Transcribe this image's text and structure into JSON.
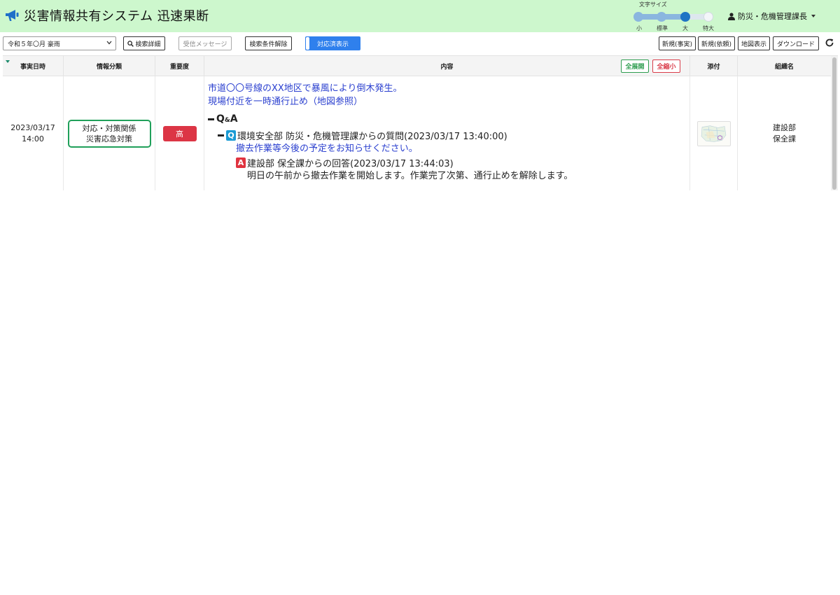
{
  "header": {
    "title": "災害情報共有システム 迅速果断",
    "font_size": {
      "label": "文字サイズ",
      "options": [
        "小",
        "標準",
        "大",
        "特大"
      ],
      "selected_index": 2
    },
    "user_name": "防災・危機管理課長"
  },
  "toolbar": {
    "event_select": "令和５年〇月 豪雨",
    "search_detail": "検索詳細",
    "received_messages": "受信メッセージ",
    "clear_conditions": "検索条件解除",
    "show_resolved": "対応済表示",
    "new_fact": "新規(事実)",
    "new_request": "新規(依頼)",
    "map_view": "地図表示",
    "download": "ダウンロード"
  },
  "table": {
    "columns": {
      "datetime": "事実日時",
      "category": "情報分類",
      "priority": "重要度",
      "content": "内容",
      "attachment": "添付",
      "organization": "組織名"
    },
    "expand_all": "全展開",
    "collapse_all": "全縮小",
    "rows": [
      {
        "date": "2023/03/17",
        "time": "14:00",
        "category_line1": "対応・対策関係",
        "category_line2": "災害応急対策",
        "priority": "高",
        "content_line1": "市道〇〇号線のXX地区で暴風により倒木発生。",
        "content_line2": "現場付近を一時通行止め（地図参照）",
        "qa_label": "Q",
        "qa_amp": "&",
        "qa_label2": "A",
        "question_badge": "Q",
        "question_header": "環境安全部 防災・危機管理課からの質問(2023/03/17 13:40:00)",
        "question_body": "撤去作業等今後の予定をお知らせください。",
        "answer_badge": "A",
        "answer_header": "建設部 保全課からの回答(2023/03/17 13:44:03)",
        "answer_body": "明日の午前から撤去作業を開始します。作業完了次第、通行止めを解除します。",
        "org_line1": "建設部",
        "org_line2": "保全課"
      }
    ]
  },
  "colors": {
    "header_bg": "#cdf7cd",
    "accent_blue": "#2f80ed",
    "link_blue": "#2a3fcf",
    "priority_red": "#dc3545",
    "category_green": "#20a05a"
  },
  "icons": {
    "app": "megaphone-icon",
    "user": "person-icon",
    "search": "search-icon",
    "refresh": "refresh-icon",
    "attachment": "map-thumbnail"
  }
}
